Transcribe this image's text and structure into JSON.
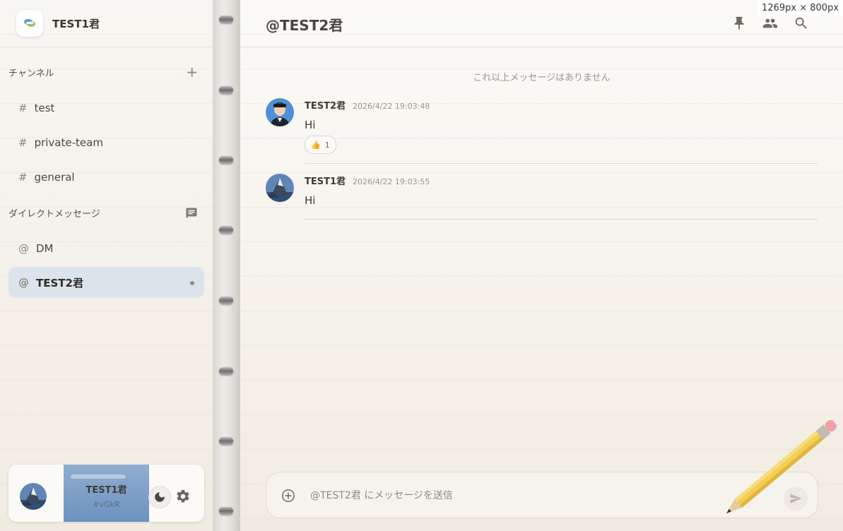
{
  "workspace": {
    "name": "TEST1君"
  },
  "sidebar": {
    "channels_header": "チャンネル",
    "channels": [
      {
        "prefix": "#",
        "label": "test"
      },
      {
        "prefix": "#",
        "label": "private-team"
      },
      {
        "prefix": "#",
        "label": "general"
      }
    ],
    "dm_header": "ダイレクトメッセージ",
    "dms": [
      {
        "prefix": "@",
        "label": "DM"
      },
      {
        "prefix": "@",
        "label": "TEST2君"
      }
    ]
  },
  "user_panel": {
    "name": "TEST1君",
    "tag": "#vGkR"
  },
  "main": {
    "title": "@TEST2君",
    "no_more_messages": "これ以上メッセージはありません",
    "messages": [
      {
        "author": "TEST2君",
        "time": "2026/4/22 19:03:48",
        "text": "Hi",
        "reaction_emoji": "👍",
        "reaction_count": "1"
      },
      {
        "author": "TEST1君",
        "time": "2026/4/22 19:03:55",
        "text": "Hi"
      }
    ],
    "composer_placeholder": "@TEST2君 にメッセージを送信"
  },
  "overlay": {
    "size_label": "1269px × 800px"
  },
  "colors": {
    "active_item_bg": "#dbe4ec",
    "profile_card": "#7d9fc8"
  }
}
